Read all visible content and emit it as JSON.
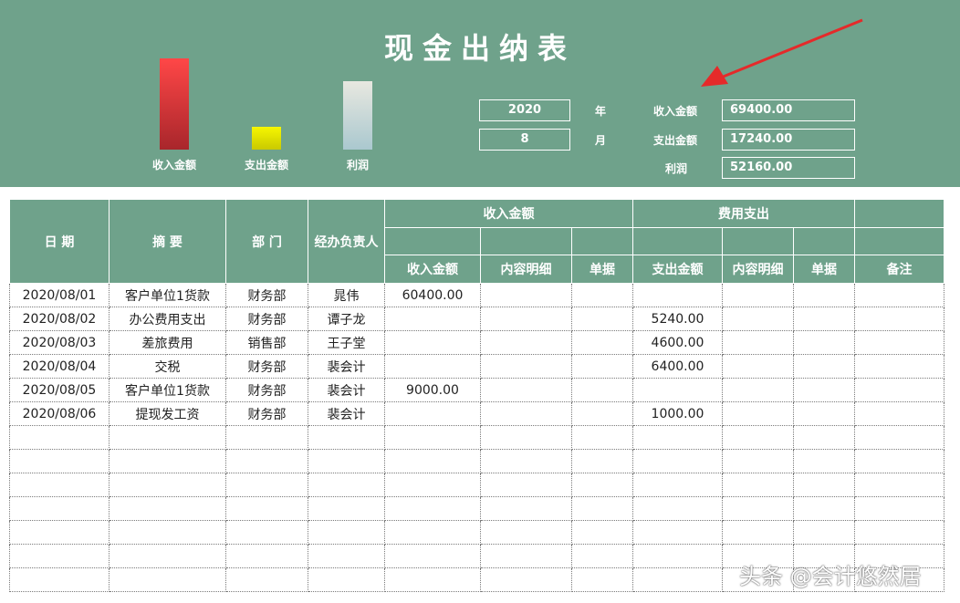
{
  "title": "现金出纳表",
  "chart_data": {
    "type": "bar",
    "categories": [
      "收入金额",
      "支出金额",
      "利润"
    ],
    "values": [
      69400,
      17240,
      52160
    ],
    "colors": [
      "#e83f3f",
      "#e6e600",
      "#d8e0d8"
    ]
  },
  "summary": {
    "year_value": "2020",
    "year_unit": "年",
    "month_value": "8",
    "month_unit": "月",
    "income_label": "收入金额",
    "income_value": "69400.00",
    "expense_label": "支出金额",
    "expense_value": "17240.00",
    "profit_label": "利润",
    "profit_value": "52160.00"
  },
  "table": {
    "headers": {
      "date": "日 期",
      "summary": "摘 要",
      "dept": "部 门",
      "handler": "经办负责人",
      "income_group": "收入金额",
      "expense_group": "费用支出",
      "income_amount": "收入金额",
      "income_detail": "内容明细",
      "income_doc": "单据",
      "expense_amount": "支出金额",
      "expense_detail": "内容明细",
      "expense_doc": "单据",
      "remark": "备注"
    },
    "rows": [
      [
        "2020/08/01",
        "客户单位1货款",
        "财务部",
        "晁伟",
        "60400.00",
        "",
        "",
        "",
        "",
        "",
        ""
      ],
      [
        "2020/08/02",
        "办公费用支出",
        "财务部",
        "谭子龙",
        "",
        "",
        "",
        "5240.00",
        "",
        "",
        ""
      ],
      [
        "2020/08/03",
        "差旅费用",
        "销售部",
        "王子堂",
        "",
        "",
        "",
        "4600.00",
        "",
        "",
        ""
      ],
      [
        "2020/08/04",
        "交税",
        "财务部",
        "裴会计",
        "",
        "",
        "",
        "6400.00",
        "",
        "",
        ""
      ],
      [
        "2020/08/05",
        "客户单位1货款",
        "财务部",
        "裴会计",
        "9000.00",
        "",
        "",
        "",
        "",
        "",
        ""
      ],
      [
        "2020/08/06",
        "提现发工资",
        "财务部",
        "裴会计",
        "",
        "",
        "",
        "1000.00",
        "",
        "",
        ""
      ],
      [
        "",
        "",
        "",
        "",
        "",
        "",
        "",
        "",
        "",
        "",
        ""
      ],
      [
        "",
        "",
        "",
        "",
        "",
        "",
        "",
        "",
        "",
        "",
        ""
      ],
      [
        "",
        "",
        "",
        "",
        "",
        "",
        "",
        "",
        "",
        "",
        ""
      ],
      [
        "",
        "",
        "",
        "",
        "",
        "",
        "",
        "",
        "",
        "",
        ""
      ],
      [
        "",
        "",
        "",
        "",
        "",
        "",
        "",
        "",
        "",
        "",
        ""
      ],
      [
        "",
        "",
        "",
        "",
        "",
        "",
        "",
        "",
        "",
        "",
        ""
      ],
      [
        "",
        "",
        "",
        "",
        "",
        "",
        "",
        "",
        "",
        "",
        ""
      ]
    ]
  },
  "watermark": "头条 @会计悠然居"
}
